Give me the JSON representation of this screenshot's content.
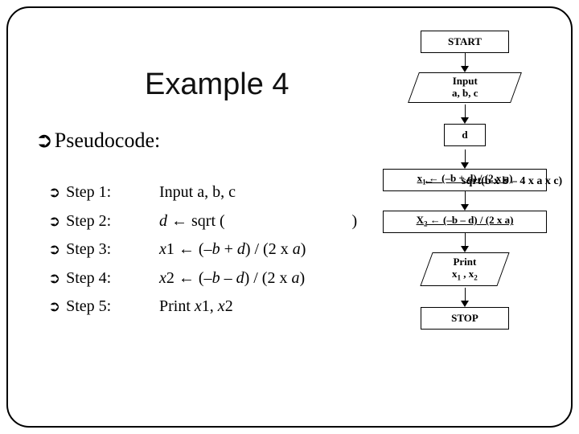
{
  "title": "Example 4",
  "heading": "Pseudocode:",
  "steps": [
    {
      "label": "Step 1:",
      "body": "Input a, b, c"
    },
    {
      "label": "Step 2:",
      "body_prefix": "d ← sqrt (",
      "body_suffix": "                              )"
    },
    {
      "label": "Step 3:",
      "body": "x1 ← (–b + d) / (2 x a)"
    },
    {
      "label": "Step 4:",
      "body": "x2 ← (–b – d) / (2 x a)"
    },
    {
      "label": "Step 5:",
      "body": "Print x1, x2"
    }
  ],
  "flow": {
    "start": "START",
    "input_l1": "Input",
    "input_l2": "a, b, c",
    "d_lhs": "d",
    "d_arrow": "←",
    "d_rhs": "sqrt(b x b – 4 x a x c)",
    "x1": "x₁ ← (–b + d) / (2 x a)",
    "x2": "X₂ ← (–b – d) / (2 x a)",
    "print_l1": "Print",
    "print_l2": "x₁ , x₂",
    "stop": "STOP"
  }
}
